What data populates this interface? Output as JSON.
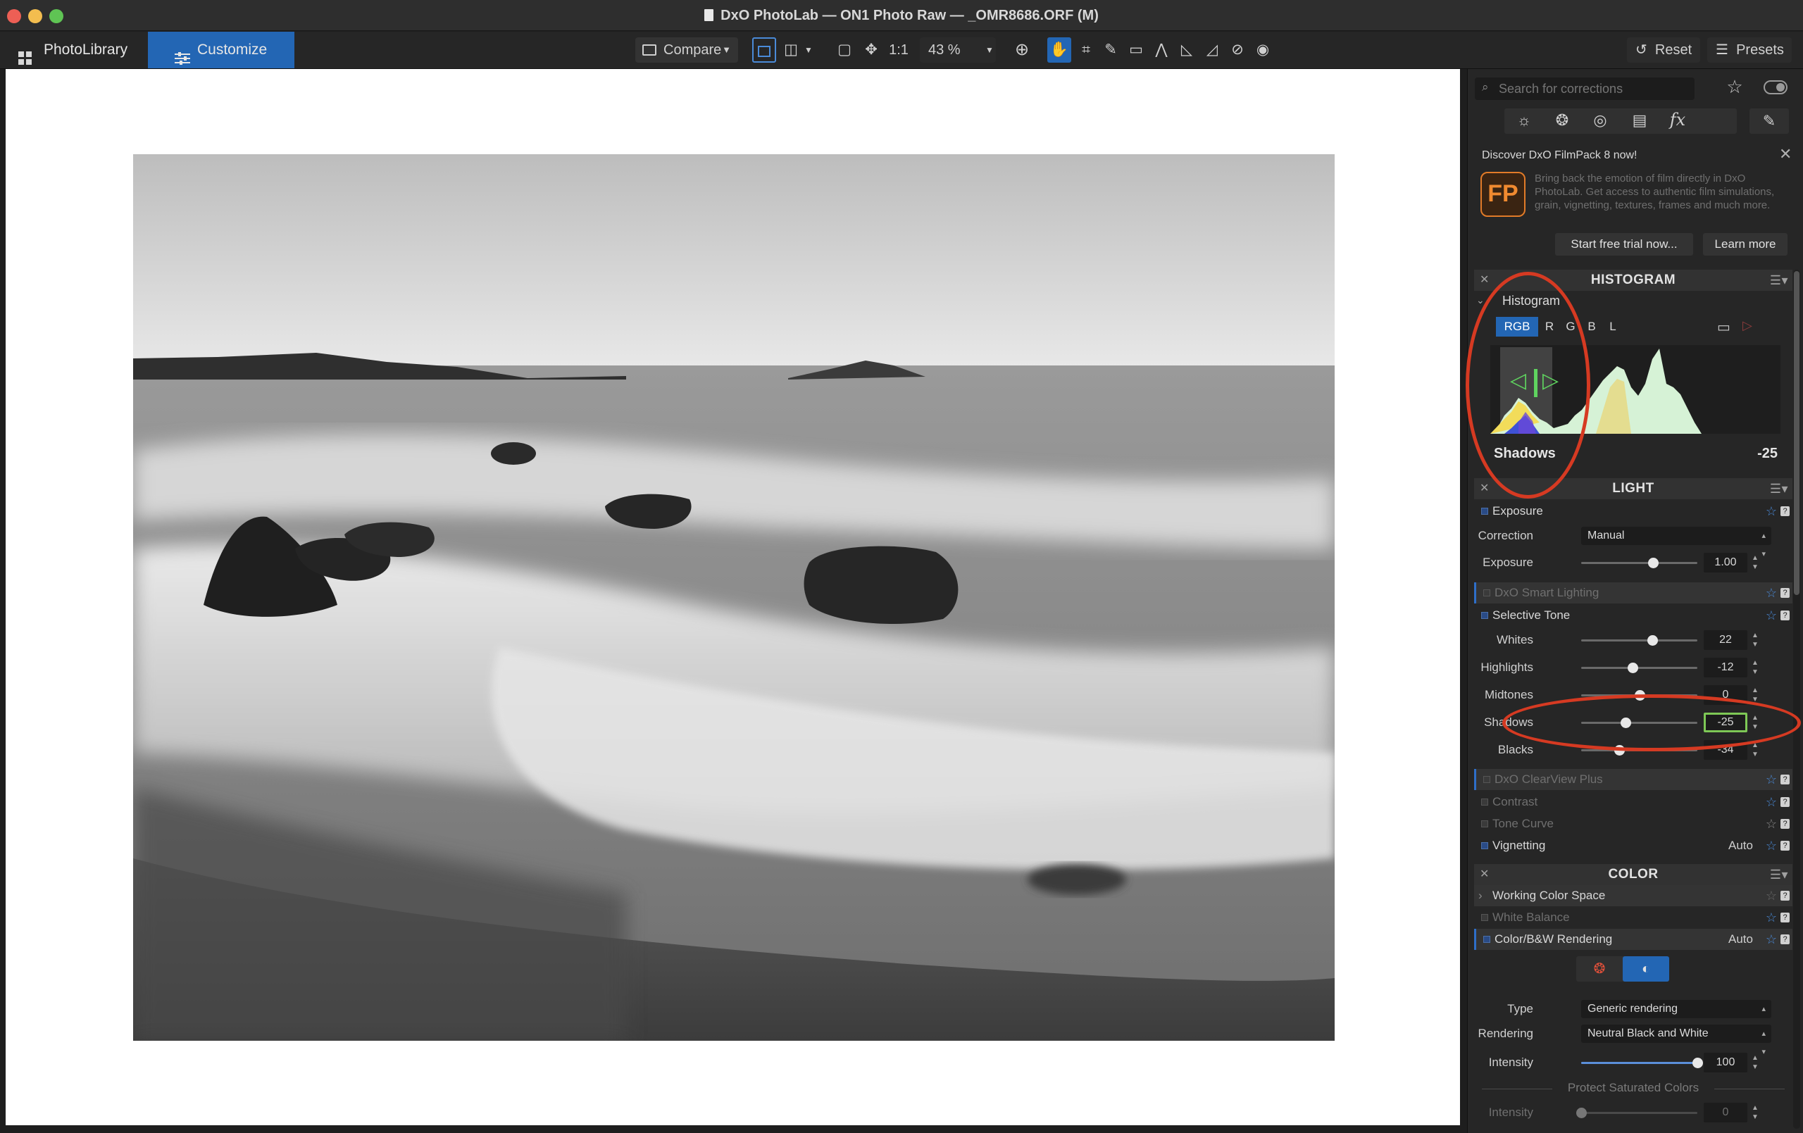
{
  "window": {
    "title": "DxO PhotoLab — ON1 Photo Raw — _OMR8686.ORF (M)"
  },
  "toolbar": {
    "photolibrary_label": "PhotoLibrary",
    "customize_label": "Customize",
    "compare_label": "Compare",
    "one_to_one_label": "1:1",
    "zoom_value": "43 %",
    "reset_label": "Reset",
    "presets_label": "Presets"
  },
  "panel": {
    "search": {
      "placeholder": "Search for corrections"
    },
    "promo": {
      "title": "Discover DxO FilmPack 8 now!",
      "logo": "FP",
      "body": "Bring back the emotion of film directly in DxO PhotoLab. Get access to authentic film simulations, grain, vignetting, textures, frames and much more.",
      "trial_button": "Start free trial now...",
      "learn_button": "Learn more"
    },
    "histogram": {
      "header": "HISTOGRAM",
      "subtitle": "Histogram",
      "channels": [
        "RGB",
        "R",
        "G",
        "B",
        "L"
      ],
      "readout_label": "Shadows",
      "readout_value": "-25"
    },
    "light": {
      "header": "LIGHT",
      "exposure": {
        "label": "Exposure",
        "correction_label": "Correction",
        "correction_value": "Manual",
        "exposure_label": "Exposure",
        "exposure_value": "1.00",
        "exposure_level": 0.62
      },
      "smart_lighting": "DxO Smart Lighting",
      "selective_tone": {
        "label": "Selective Tone",
        "sliders": [
          {
            "label": "Whites",
            "value": "22",
            "level": 0.61
          },
          {
            "label": "Highlights",
            "value": "-12",
            "level": 0.44
          },
          {
            "label": "Midtones",
            "value": "0",
            "level": 0.5
          },
          {
            "label": "Shadows",
            "value": "-25",
            "level": 0.38
          },
          {
            "label": "Blacks",
            "value": "-34",
            "level": 0.33
          }
        ]
      },
      "clearview": "DxO ClearView Plus",
      "contrast": "Contrast",
      "tone_curve": "Tone Curve",
      "vignetting": {
        "label": "Vignetting",
        "mode": "Auto"
      }
    },
    "color": {
      "header": "COLOR",
      "working_color_space": "Working Color Space",
      "white_balance": "White Balance",
      "rendering_tool": {
        "label": "Color/B&W Rendering",
        "mode": "Auto"
      },
      "type_label": "Type",
      "type_value": "Generic rendering",
      "rendering_label": "Rendering",
      "rendering_value": "Neutral Black and White",
      "intensity_label": "Intensity",
      "intensity_value": "100",
      "intensity_level": 1.0,
      "protect_label": "Protect Saturated Colors",
      "protect_intensity_label": "Intensity",
      "protect_intensity_value": "0",
      "protect_intensity_level": 0.0
    }
  },
  "colors": {
    "accent": "#2e6fc9",
    "annotation": "#d63a22",
    "value_highlight": "#7ec856"
  }
}
